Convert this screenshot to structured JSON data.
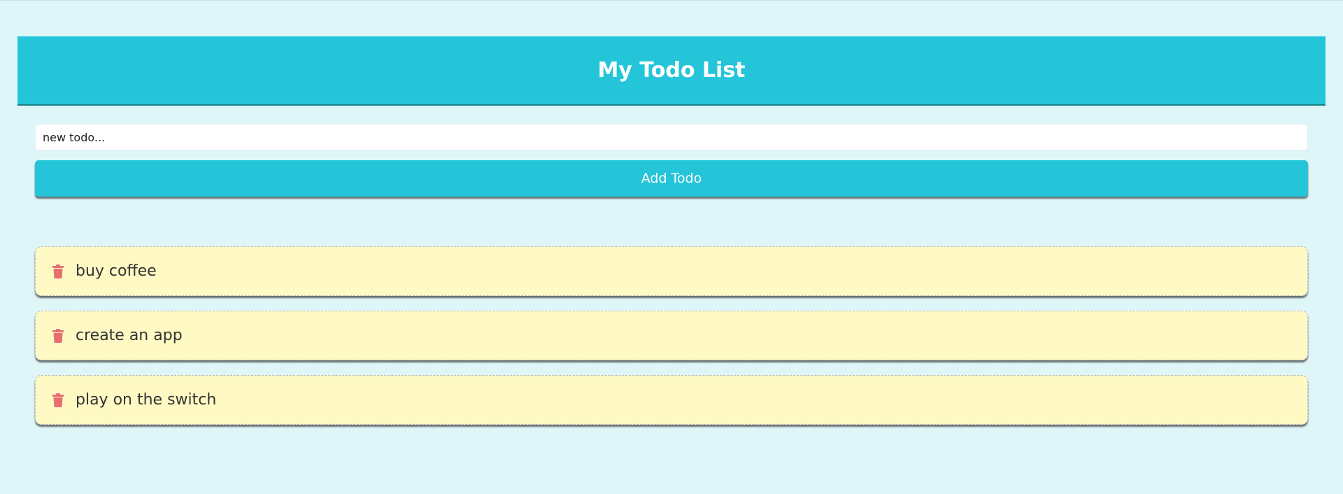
{
  "header": {
    "title": "My Todo List"
  },
  "form": {
    "input_value": "new todo...",
    "add_label": "Add Todo"
  },
  "todos": [
    {
      "text": "buy coffee",
      "icon": "trash-icon"
    },
    {
      "text": "create an app",
      "icon": "trash-icon"
    },
    {
      "text": "play on the switch",
      "icon": "trash-icon"
    }
  ],
  "colors": {
    "background": "#dff6f9",
    "accent": "#25c5d9",
    "todo_bg": "#fff9c4",
    "trash": "#e86e6e"
  }
}
